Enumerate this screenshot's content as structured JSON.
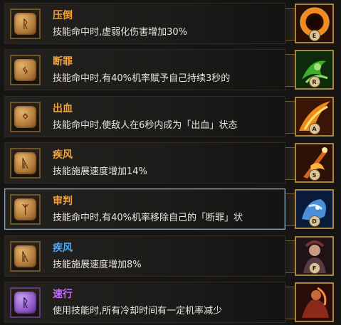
{
  "rows": [
    {
      "title": "压倒",
      "desc": "技能命中时,虚弱化伤害增加30%",
      "key": "E",
      "title_color": "#f2a23a",
      "rune": "ᚱ",
      "rune_icon": "rune-icon"
    },
    {
      "title": "断罪",
      "desc": "技能命中时,有40%机率赋予自己持续3秒的",
      "key": "R",
      "title_color": "#f2a23a",
      "rune": "ᛃ",
      "rune_icon": "rune-icon"
    },
    {
      "title": "出血",
      "desc": "技能命中时,使敌人在6秒内成为「出血」状态",
      "key": "A",
      "title_color": "#f2a23a",
      "rune": "ᛜ",
      "rune_icon": "rune-icon"
    },
    {
      "title": "疾风",
      "desc": "技能施展速度增加14%",
      "key": "S",
      "title_color": "#f2a23a",
      "rune": "ᚣ",
      "rune_icon": "rune-icon"
    },
    {
      "title": "审判",
      "desc": "技能命中时,有40%机率移除自己的「断罪」状",
      "key": "D",
      "title_color": "#f2a23a",
      "rune": "ᛉ",
      "rune_icon": "rune-icon"
    },
    {
      "title": "疾风",
      "desc": "技能施展速度增加8%",
      "key": "F",
      "title_color": "#4aa6ff",
      "rune": "ᚣ",
      "rune_icon": "rune-icon"
    },
    {
      "title": "速行",
      "desc": "使用技能时,所有冷却时间有一定机率减少",
      "key": "",
      "title_color": "#c46bff",
      "rune": "ᚱ",
      "rune_icon": "rune-icon"
    }
  ],
  "skill_icons": [
    "fire-ring-icon",
    "green-swirl-icon",
    "fire-slash-icon",
    "flame-blade-icon",
    "ice-beast-icon",
    "warrior-portrait-icon",
    "fire-warrior-icon"
  ]
}
